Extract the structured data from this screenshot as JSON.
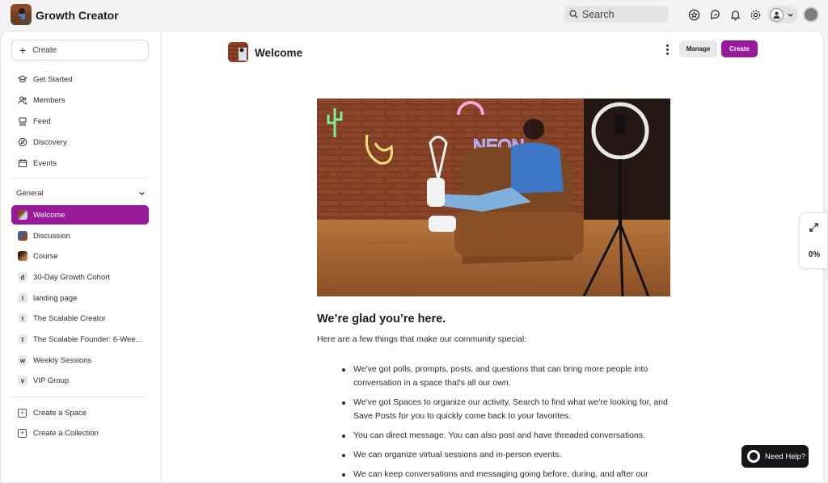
{
  "app": {
    "name": "Growth Creator"
  },
  "search": {
    "placeholder": "Search"
  },
  "sidebar": {
    "create_label": "Create",
    "nav": [
      {
        "label": "Get Started",
        "icon": "graduation-cap-icon"
      },
      {
        "label": "Members",
        "icon": "members-icon"
      },
      {
        "label": "Feed",
        "icon": "feed-icon"
      },
      {
        "label": "Discovery",
        "icon": "compass-icon"
      },
      {
        "label": "Events",
        "icon": "calendar-icon"
      }
    ],
    "section_title": "General",
    "spaces": [
      {
        "label": "Welcome",
        "active": true
      },
      {
        "label": "Discussion"
      },
      {
        "label": "Course"
      },
      {
        "label": "30-Day Growth Cohort",
        "letter": "d"
      },
      {
        "label": "landing page",
        "letter": "l"
      },
      {
        "label": "The Scalable Creator",
        "letter": "t"
      },
      {
        "label": "The Scalable Founder: 6-Wee...",
        "letter": "t"
      },
      {
        "label": "Weekly Sessions",
        "letter": "w"
      },
      {
        "label": "VIP Group",
        "letter": "v"
      }
    ],
    "footer": [
      {
        "label": "Create a Space"
      },
      {
        "label": "Create a Collection"
      }
    ]
  },
  "page": {
    "title": "Welcome",
    "manage_label": "Manage",
    "create_label": "Create",
    "heading": "We’re glad you’re here.",
    "intro": "Here are a few things that make our community special:",
    "bullets": [
      "We've got polls, prompts, posts, and questions that can bring more people into conversation in a space that's all our own.",
      "We've got Spaces to organize our activity, Search to find what we're looking for, and Save Posts for you to quickly come back to your favorites.",
      "You can direct message. You can also post and have threaded conversations.",
      "We can organize virtual sessions and in-person events.",
      "We can keep conversations and messaging going before, during, and after our"
    ]
  },
  "side_tools": {
    "progress": "0%"
  },
  "help": {
    "label": "Need Help?"
  },
  "colors": {
    "accent": "#981a98",
    "help_bg": "#15161a"
  }
}
